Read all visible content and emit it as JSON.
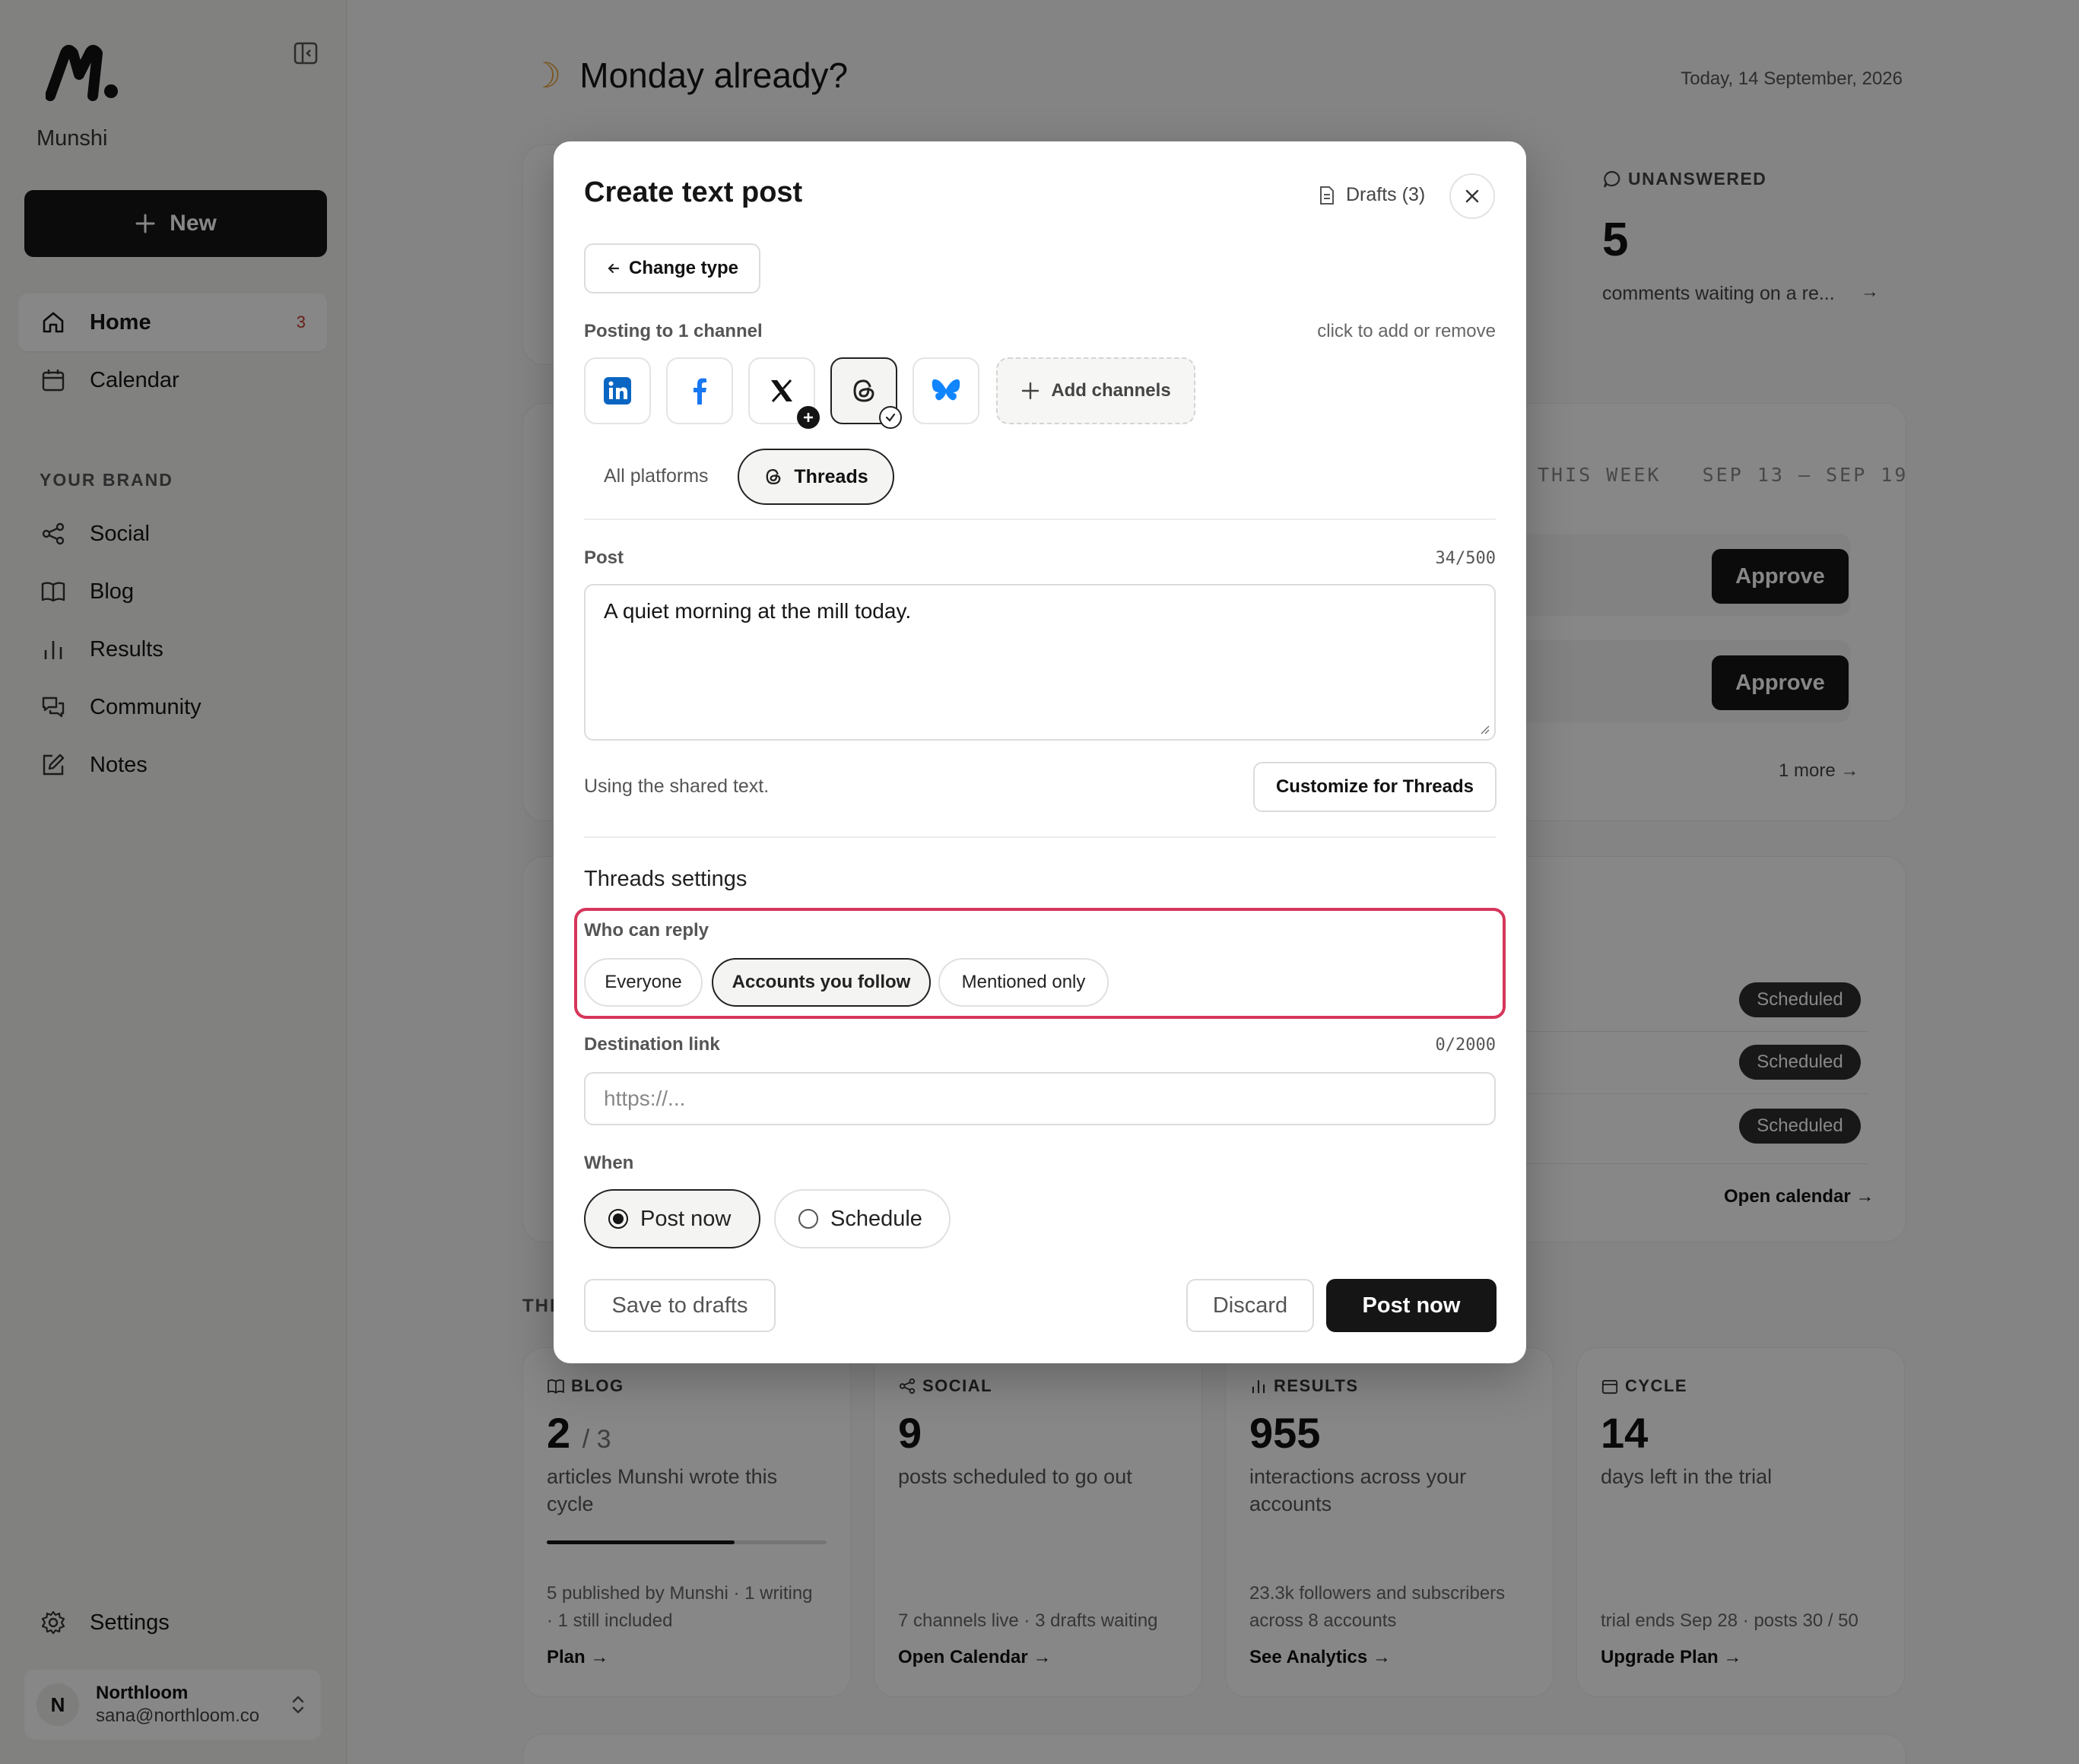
{
  "sidebar": {
    "brand": "Munshi",
    "new_button": "New",
    "nav": [
      {
        "label": "Home",
        "badge": "3"
      },
      {
        "label": "Calendar"
      }
    ],
    "section_label": "YOUR BRAND",
    "brand_nav": [
      {
        "label": "Social"
      },
      {
        "label": "Blog"
      },
      {
        "label": "Results"
      },
      {
        "label": "Community"
      },
      {
        "label": "Notes"
      }
    ],
    "settings": "Settings",
    "account": {
      "initial": "N",
      "name": "Northloom",
      "email": "sana@northloom.co"
    }
  },
  "main": {
    "greeting": "Monday already?",
    "date": "Today, 14 September, 2026",
    "unanswered": {
      "label": "UNANSWERED",
      "value": "5",
      "text": "comments waiting on a re...",
      "arrow": "→"
    },
    "week": {
      "label": "THIS WEEK",
      "range": "SEP 13 – SEP 19"
    },
    "approve_label": "Approve",
    "more": "1 more",
    "scheduled_label": "Scheduled",
    "open_calendar": "Open calendar →",
    "cycle_section": "THI",
    "stats": [
      {
        "label": "BLOG",
        "value": "2",
        "sub": "/ 3",
        "desc": "articles Munshi wrote this cycle",
        "foot": "5 published by Munshi · 1 writing · 1 still included",
        "link": "Plan →",
        "progress": 0.67
      },
      {
        "label": "SOCIAL",
        "value": "9",
        "desc": "posts scheduled to go out",
        "foot": "7 channels live · 3 drafts waiting",
        "link": "Open Calendar →"
      },
      {
        "label": "RESULTS",
        "value": "955",
        "desc": "interactions across your accounts",
        "foot": "23.3k followers and subscribers across 8 accounts",
        "link": "See Analytics →"
      },
      {
        "label": "CYCLE",
        "value": "14",
        "desc": "days left in the trial",
        "foot": "trial ends Sep 28 · posts 30 / 50",
        "link": "Upgrade Plan →"
      }
    ]
  },
  "modal": {
    "title": "Create text post",
    "drafts": "Drafts (3)",
    "change_type": "Change type",
    "posting_label": "Posting to 1 channel",
    "posting_hint": "click to add or remove",
    "channels": [
      "LinkedIn",
      "Facebook",
      "X",
      "Threads",
      "Bluesky"
    ],
    "add_channels": "Add channels",
    "tab_all": "All platforms",
    "tab_threads": "Threads",
    "post_label": "Post",
    "post_count": "34/500",
    "post_text": "A quiet morning at the mill today.",
    "shared_text": "Using the shared text.",
    "customize": "Customize for Threads",
    "settings_title": "Threads settings",
    "reply_label": "Who can reply",
    "reply_options": [
      "Everyone",
      "Accounts you follow",
      "Mentioned only"
    ],
    "reply_selected": "Accounts you follow",
    "dest_label": "Destination link",
    "dest_count": "0/2000",
    "dest_placeholder": "https://...",
    "when_label": "When",
    "when_options": [
      "Post now",
      "Schedule"
    ],
    "when_selected": "Post now",
    "save_drafts": "Save to drafts",
    "discard": "Discard",
    "post_now": "Post now"
  },
  "colors": {
    "highlight": "#d6365a",
    "accent": "#151515",
    "badge": "#c23b2a"
  }
}
